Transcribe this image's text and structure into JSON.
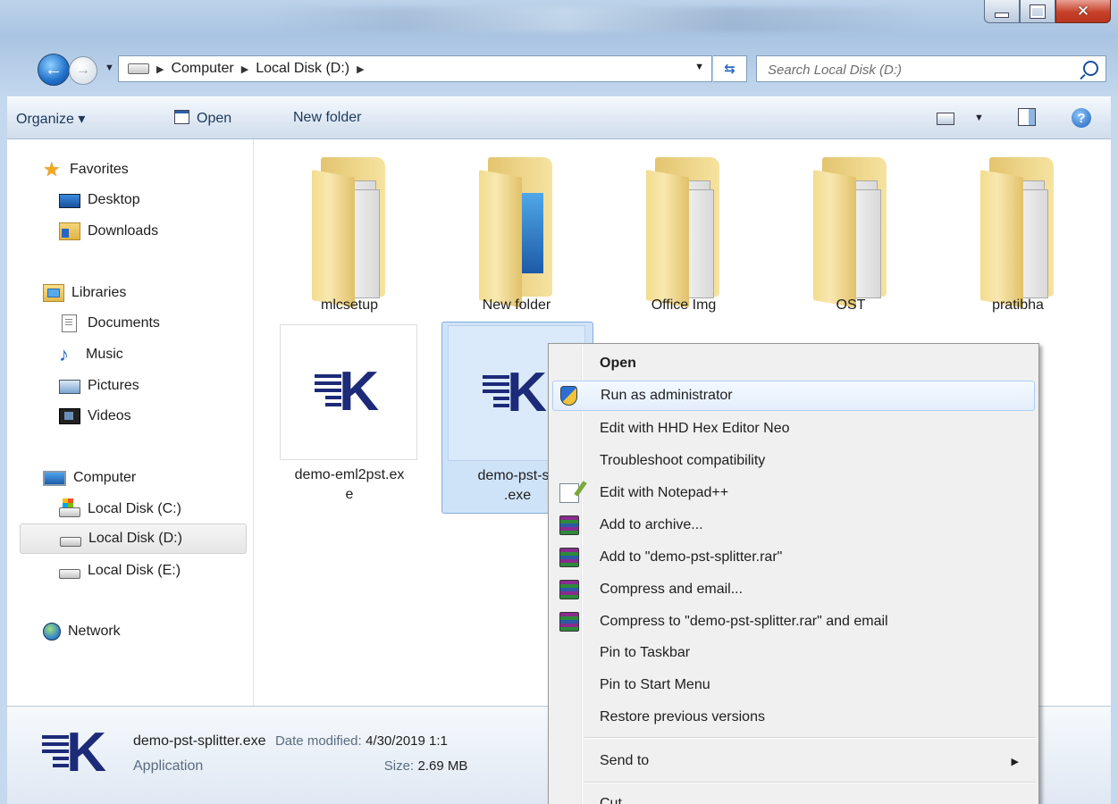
{
  "address": {
    "crumbs": [
      "Computer",
      "Local Disk (D:)"
    ],
    "search_placeholder": "Search Local Disk (D:)"
  },
  "toolbar": {
    "organize": "Organize ▾",
    "open": "Open",
    "new_folder": "New folder"
  },
  "nav": {
    "favorites": "Favorites",
    "desktop": "Desktop",
    "downloads": "Downloads",
    "libraries": "Libraries",
    "documents": "Documents",
    "music": "Music",
    "pictures": "Pictures",
    "videos": "Videos",
    "computer": "Computer",
    "disk_c": "Local Disk (C:)",
    "disk_d": "Local Disk (D:)",
    "disk_e": "Local Disk (E:)",
    "network": "Network"
  },
  "files": {
    "f1": "mlcsetup",
    "f2": "New folder",
    "f3": "Office Img",
    "f4": "OST",
    "f5": "pratibha",
    "e1_line1": "demo-eml2pst.ex",
    "e1_line2": "e",
    "e2_line1": "demo-pst-sp",
    "e2_line2": ".exe"
  },
  "details": {
    "name": "demo-pst-splitter.exe",
    "date_label": "Date modified:",
    "date_value": "4/30/2019 1:1",
    "type": "Application",
    "size_label": "Size:",
    "size_value": "2.69 MB"
  },
  "context_menu": {
    "open": "Open",
    "run_admin": "Run as administrator",
    "hex": "Edit with HHD Hex Editor Neo",
    "troubleshoot": "Troubleshoot compatibility",
    "notepad": "Edit with Notepad++",
    "add_archive": "Add to archive...",
    "add_rar": "Add to \"demo-pst-splitter.rar\"",
    "compress_email": "Compress and email...",
    "compress_rar_email": "Compress to \"demo-pst-splitter.rar\" and email",
    "pin_taskbar": "Pin to Taskbar",
    "pin_start": "Pin to Start Menu",
    "restore": "Restore previous versions",
    "send_to": "Send to",
    "cut": "Cut"
  }
}
